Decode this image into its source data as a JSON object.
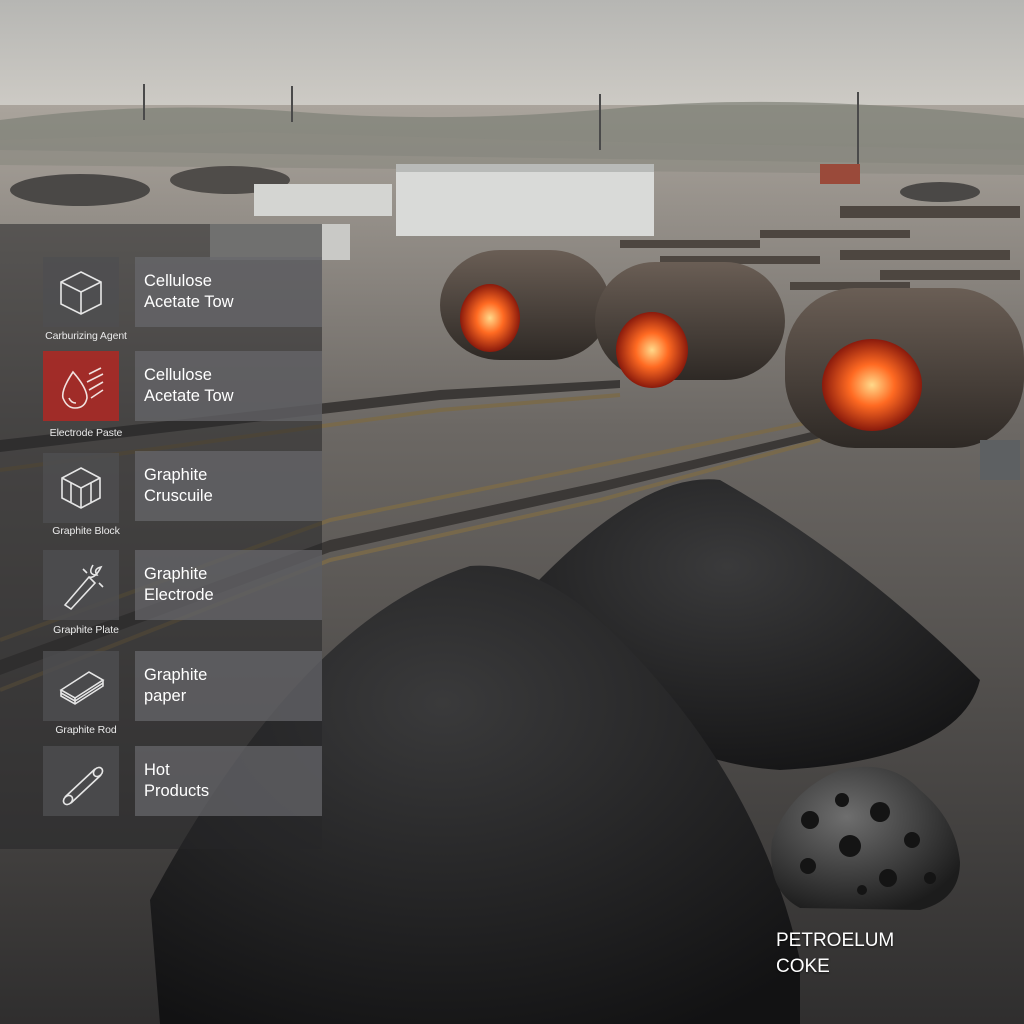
{
  "products": [
    {
      "icon": "cube-icon",
      "caption": "Carburizing Agent",
      "label": "Cellulose\nAcetate Tow"
    },
    {
      "icon": "droplet-icon",
      "caption": "Electrode Paste",
      "label": "Cellulose\nAcetate Tow"
    },
    {
      "icon": "hexagon-block-icon",
      "caption": "Graphite Block",
      "label": "Graphite\nCruscuile"
    },
    {
      "icon": "electrode-spark-icon",
      "caption": "Graphite Plate",
      "label": "Graphite\nElectrode"
    },
    {
      "icon": "paper-stack-icon",
      "caption": "Graphite Rod",
      "label": "Graphite\npaper"
    },
    {
      "icon": "rod-icon",
      "caption": "",
      "label": "Hot\nProducts"
    }
  ],
  "feature": {
    "label": "PETROELUM\n    COKE"
  },
  "colors": {
    "accent_red": "#a82a26",
    "furnace_glow": "#ff5a1f"
  }
}
